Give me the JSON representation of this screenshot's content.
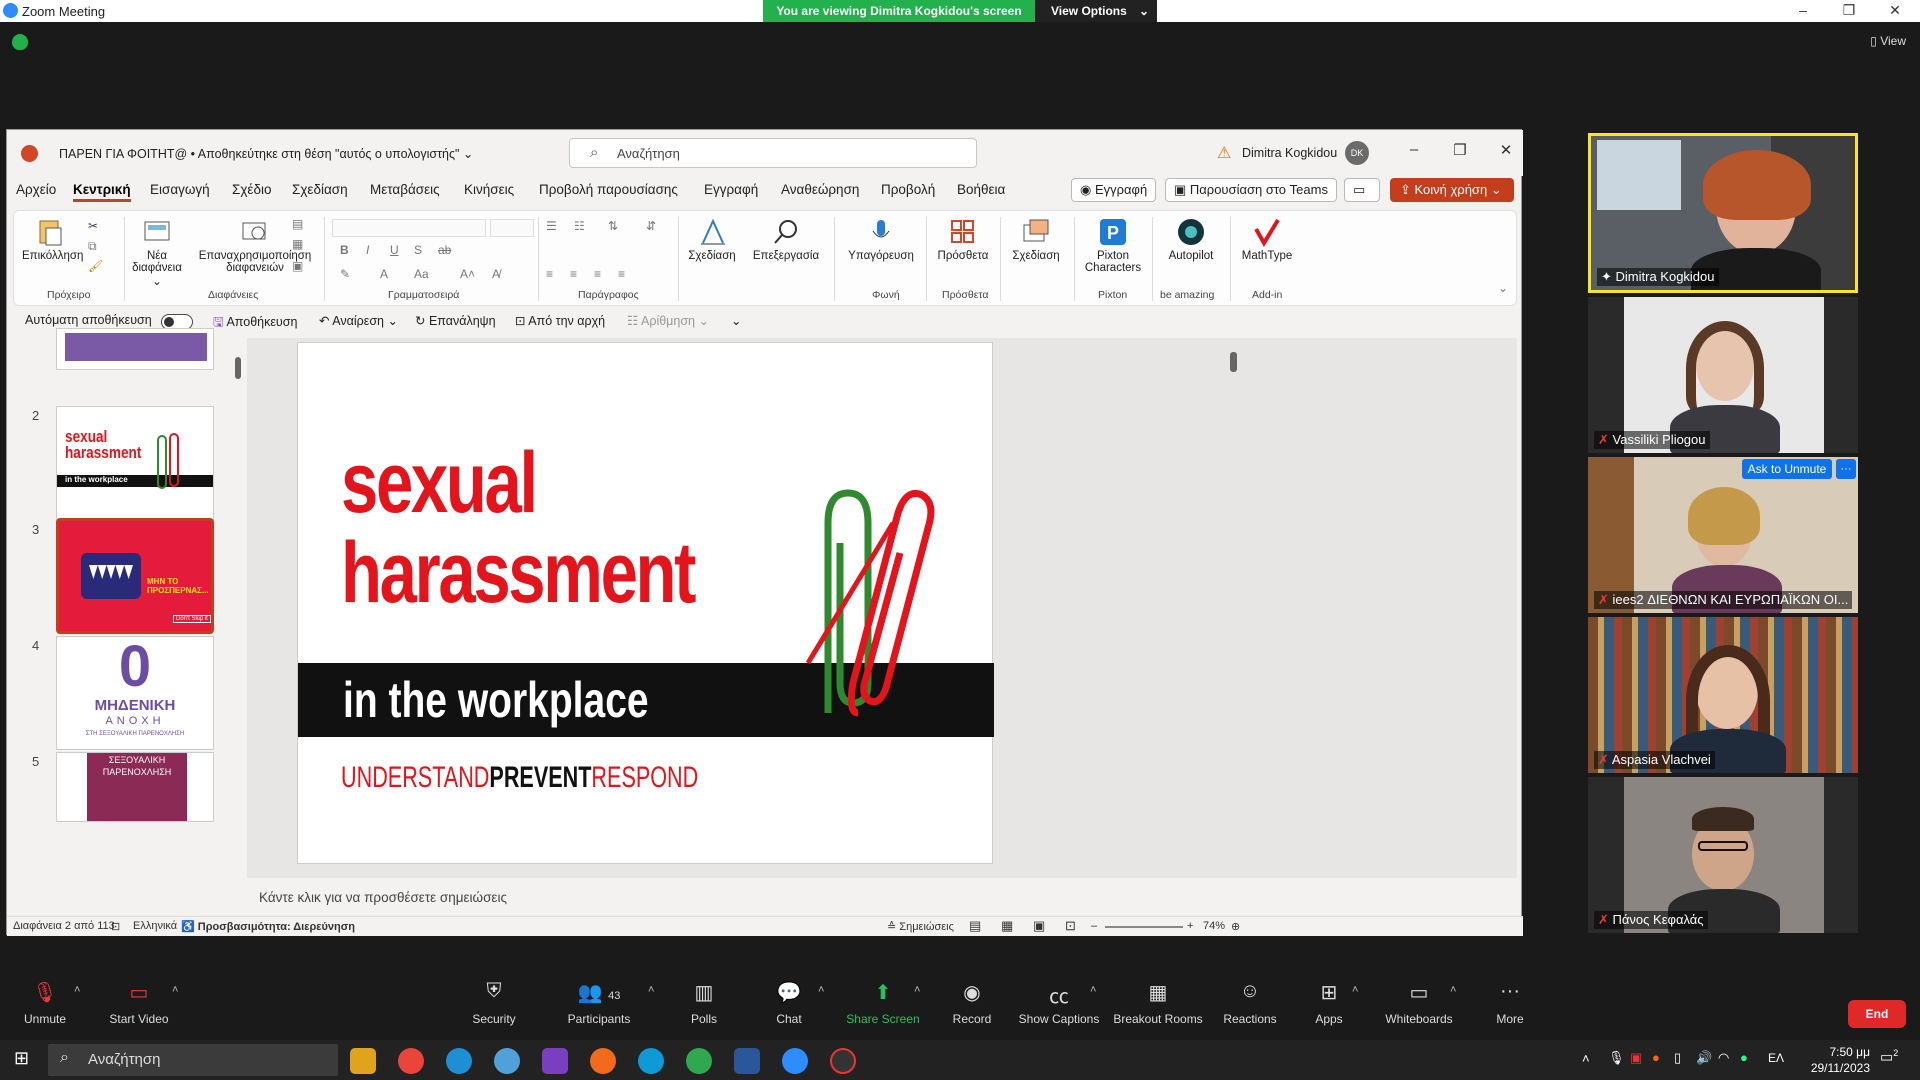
{
  "zoom": {
    "window_title": "Zoom Meeting",
    "share_message": "You are viewing Dimitra Kogkidou's screen",
    "view_options": "View Options",
    "view_label": "View",
    "end": "End",
    "toolbar": [
      {
        "label": "Unmute",
        "icon": "mic-muted-icon"
      },
      {
        "label": "Start Video",
        "icon": "video-off-icon"
      },
      {
        "label": "Security",
        "icon": "shield-icon"
      },
      {
        "label": "Participants",
        "icon": "participants-icon",
        "count": "43"
      },
      {
        "label": "Polls",
        "icon": "polls-icon"
      },
      {
        "label": "Chat",
        "icon": "chat-icon"
      },
      {
        "label": "Share Screen",
        "icon": "share-screen-icon"
      },
      {
        "label": "Record",
        "icon": "record-icon"
      },
      {
        "label": "Show Captions",
        "icon": "cc-icon"
      },
      {
        "label": "Breakout Rooms",
        "icon": "breakout-icon"
      },
      {
        "label": "Reactions",
        "icon": "reactions-icon"
      },
      {
        "label": "Apps",
        "icon": "apps-icon"
      },
      {
        "label": "Whiteboards",
        "icon": "whiteboard-icon"
      },
      {
        "label": "More",
        "icon": "more-icon"
      }
    ],
    "participants": [
      {
        "name": "Dimitra Kogkidou"
      },
      {
        "name": "Vassiliki Pliogou"
      },
      {
        "name": "iees2 ΔΙΕΘΝΩΝ ΚΑΙ ΕΥΡΩΠΑΪΚΩΝ ΟΙ...",
        "action": "Ask to Unmute",
        "more": "···"
      },
      {
        "name": "Aspasia Vlachvei"
      },
      {
        "name": "Πάνος Κεφαλάς"
      }
    ]
  },
  "ppt": {
    "title": "ΠΑΡΕΝ ΓΙΑ ΦΟΙΤΗΤ@ • Αποθηκεύτηκε στη θέση \"αυτός ο υπολογιστής\" ⌄",
    "search_placeholder": "Αναζήτηση",
    "user_name": "Dimitra Kogkidou",
    "user_initials": "DK",
    "menu": [
      "Αρχείο",
      "Κεντρική",
      "Εισαγωγή",
      "Σχέδιο",
      "Σχεδίαση",
      "Μεταβάσεις",
      "Κινήσεις",
      "Προβολή παρουσίασης",
      "Εγγραφή",
      "Αναθεώρηση",
      "Προβολή",
      "Βοήθεια"
    ],
    "record_btn": "Εγγραφή",
    "teams_btn": "Παρουσίαση στο Teams",
    "share_btn": "Κοινή χρήση",
    "ribbon": {
      "paste": "Επικόλληση",
      "clipboard": "Πρόχειρο",
      "new_slide": "Νέα διαφάνεια",
      "reuse": "Επαναχρησιμοποίηση διαφανειών",
      "slides": "Διαφάνειες",
      "font": "Γραμματοσειρά",
      "paragraph": "Παράγραφος",
      "draw": "Σχεδίαση",
      "edit": "Επεξεργασία",
      "dictate": "Υπαγόρευση",
      "voice": "Φωνή",
      "addins": "Πρόσθετα",
      "addins_group": "Πρόσθετα",
      "designer": "Σχεδίαση",
      "pixton": "Pixton Characters",
      "pixton_group": "Pixton",
      "autopilot": "Autopilot",
      "autopilot_group": "be amazing",
      "mathtype": "MathType",
      "addin_group": "Add-in"
    },
    "qat": {
      "autosave": "Αυτόματη αποθήκευση",
      "save": "Αποθήκευση",
      "undo": "Αναίρεση",
      "redo": "Επανάληψη",
      "from_start": "Από την αρχή",
      "numbering": "Αρίθμηση"
    },
    "thumbnails": [
      {
        "num": "2"
      },
      {
        "num": "3"
      },
      {
        "num": "4"
      },
      {
        "num": "5"
      }
    ],
    "thumb_texts": {
      "t4_big": "0",
      "t4_line1": "ΜΗΔΕΝΙΚΗ",
      "t4_line2": "ΑΝΟΧΗ",
      "t4_line3": "ΣΤΗ ΣΕΞΟΥΑΛΙΚΗ ΠΑΡΕΝΟΧΛΗΣΗ",
      "t5_line1": "ΣΕΞΟΥΑΛΙΚΗ",
      "t5_line2": "ΠΑΡΕΝΟΧΛΗΣΗ",
      "t3_text": "ΜΗΝ ΤΟ ΠΡΟΣΠΕΡΝΑΣ...",
      "t3_btn": "Don't Skip it"
    },
    "slide": {
      "line1": "sexual",
      "line2": "harassment",
      "line3": "in the workplace",
      "tag_a": "UNDERSTAND",
      "tag_b": "PREVENT",
      "tag_c": "RESPOND"
    },
    "notes_placeholder": "Κάντε κλικ για να προσθέσετε σημειώσεις",
    "status": {
      "slide_of": "Διαφάνεια 2 από 113",
      "language": "Ελληνικά",
      "accessibility": "Προσβασιμότητα: Διερεύνηση",
      "notes": "Σημειώσεις",
      "zoom": "74%"
    }
  },
  "taskbar": {
    "search": "Αναζήτηση",
    "lang": "ΕΛ",
    "time": "7:50 μμ",
    "date": "29/11/2023",
    "notif": "2"
  }
}
